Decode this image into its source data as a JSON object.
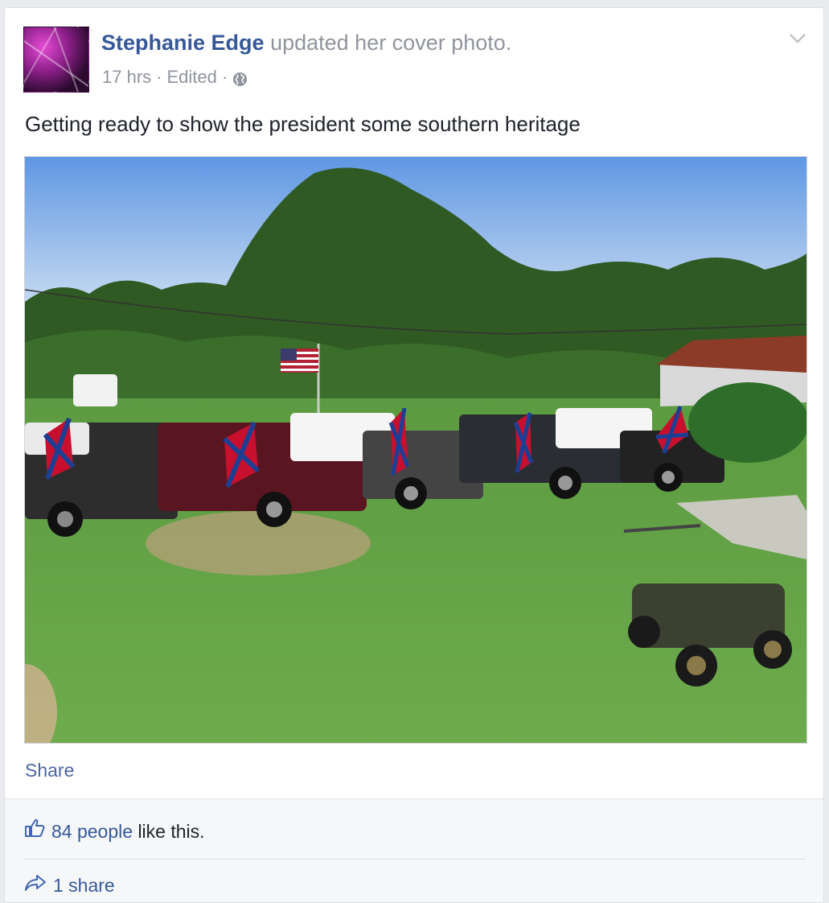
{
  "post": {
    "author": "Stephanie Edge",
    "action": "updated her cover photo.",
    "time": "17 hrs",
    "edited": "Edited",
    "separator": "·",
    "privacy_icon": "globe-icon",
    "menu_icon": "chevron-down-icon",
    "text": "Getting ready to show the president some southern heritage",
    "share_label": "Share"
  },
  "footer": {
    "like_icon": "thumbs-up-icon",
    "likes_count": "84 people",
    "likes_suffix": "like this.",
    "share_icon": "share-arrow-icon",
    "shares": "1 share"
  },
  "colors": {
    "link": "#365899",
    "meta": "#90949c",
    "text": "#1d2129",
    "footer_bg": "#f6f7f9"
  }
}
